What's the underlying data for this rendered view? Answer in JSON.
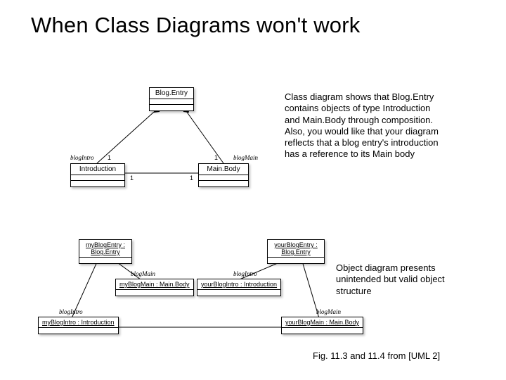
{
  "title": "When Class Diagrams won't work",
  "para1": "Class diagram shows that Blog.Entry contains objects of type Introduction and Main.Body through composition.\nAlso, you would like that your diagram reflects that a blog entry's introduction has a reference to its Main body",
  "para2": "Object diagram presents unintended but valid object structure",
  "caption": "Fig. 11.3 and 11.4  from [UML 2]",
  "classDiagram": {
    "classes": {
      "blogEntry": "Blog.Entry",
      "introduction": "Introduction",
      "mainBody": "Main.Body"
    },
    "assoc": {
      "blogIntroRole": "blogIntro",
      "blogMainRole": "blogMain",
      "mult1a": "1",
      "mult1b": "1",
      "mult1c": "1",
      "mult1d": "1"
    }
  },
  "objectDiagram": {
    "objects": {
      "myBlogEntry": "myBlogEntry :\nBlog.Entry",
      "yourBlogEntry": "yourBlogEntry :\nBlog.Entry",
      "myBlogMain": "myBlogMain : Main.Body",
      "yourBlogIntro": "yourBlogIntro : Introduction",
      "myBlogIntro": "myBlogIntro : Introduction",
      "yourBlogMain": "yourBlogMain : Main.Body"
    },
    "roles": {
      "blogMain1": "blogMain",
      "blogIntro1": "blogIntro",
      "blogIntro2": "blogIntro",
      "blogMain2": "blogMain"
    }
  }
}
